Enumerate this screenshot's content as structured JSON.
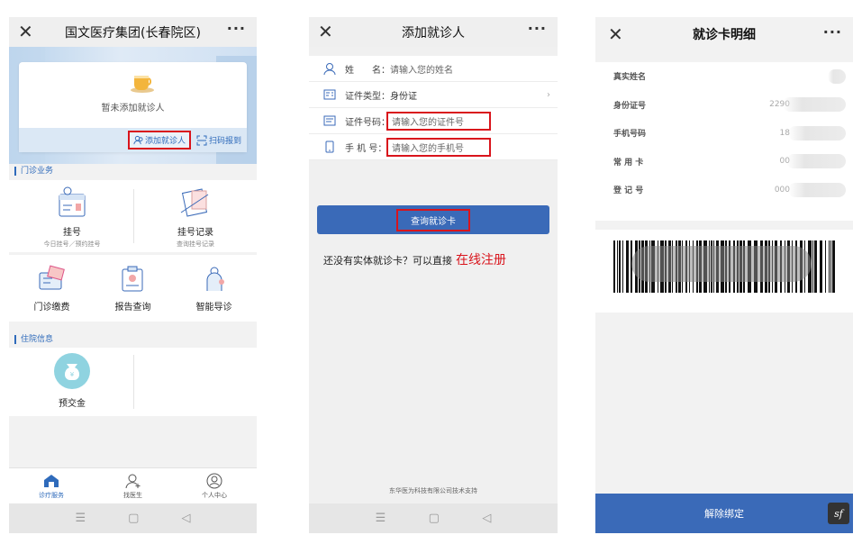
{
  "panel1": {
    "title": "国文医疗集团(长春院区)",
    "close": "✕",
    "more": "···",
    "no_patient": "暂未添加就诊人",
    "add_patient": "添加就诊人",
    "scan_checkin": "扫码报到",
    "section_outpatient": "门诊业务",
    "tiles_top": [
      {
        "label": "挂号",
        "sub": "今日挂号／预约挂号"
      },
      {
        "label": "挂号记录",
        "sub": "查询挂号记录"
      }
    ],
    "tiles_three": [
      {
        "label": "门诊缴费"
      },
      {
        "label": "报告查询"
      },
      {
        "label": "智能导诊"
      }
    ],
    "section_inpatient": "住院信息",
    "deposit": "预交金",
    "tabs": [
      {
        "label": "诊疗服务",
        "icon": "home-icon"
      },
      {
        "label": "找医生",
        "icon": "add-person-icon"
      },
      {
        "label": "个人中心",
        "icon": "face-icon"
      }
    ]
  },
  "panel2": {
    "title": "添加就诊人",
    "close": "✕",
    "more": "···",
    "rows": [
      {
        "label": "姓　　名：",
        "placeholder": "请输入您的姓名"
      },
      {
        "label": "证件类型：",
        "value": "身份证"
      },
      {
        "label": "证件号码：",
        "placeholder": "请输入您的证件号"
      },
      {
        "label": "手 机 号：",
        "placeholder": "请输入您的手机号"
      }
    ],
    "query_button": "查询就诊卡",
    "register_prompt": "还没有实体就诊卡？可以直接",
    "register_link": "在线注册",
    "footer": "东华医为科技有限公司技术支持"
  },
  "panel3": {
    "title": "就诊卡明细",
    "close": "✕",
    "more": "···",
    "fields": [
      {
        "label": "真实姓名",
        "value": ""
      },
      {
        "label": "身份证号",
        "value": "2290"
      },
      {
        "label": "手机号码",
        "value": "18"
      },
      {
        "label": "常 用 卡",
        "value": "00"
      },
      {
        "label": "登 记 号",
        "value": "000"
      }
    ],
    "unbind": "解除绑定",
    "badge": "sf"
  },
  "colors": {
    "accent": "#3a6ab8",
    "highlight": "#d9141c"
  }
}
